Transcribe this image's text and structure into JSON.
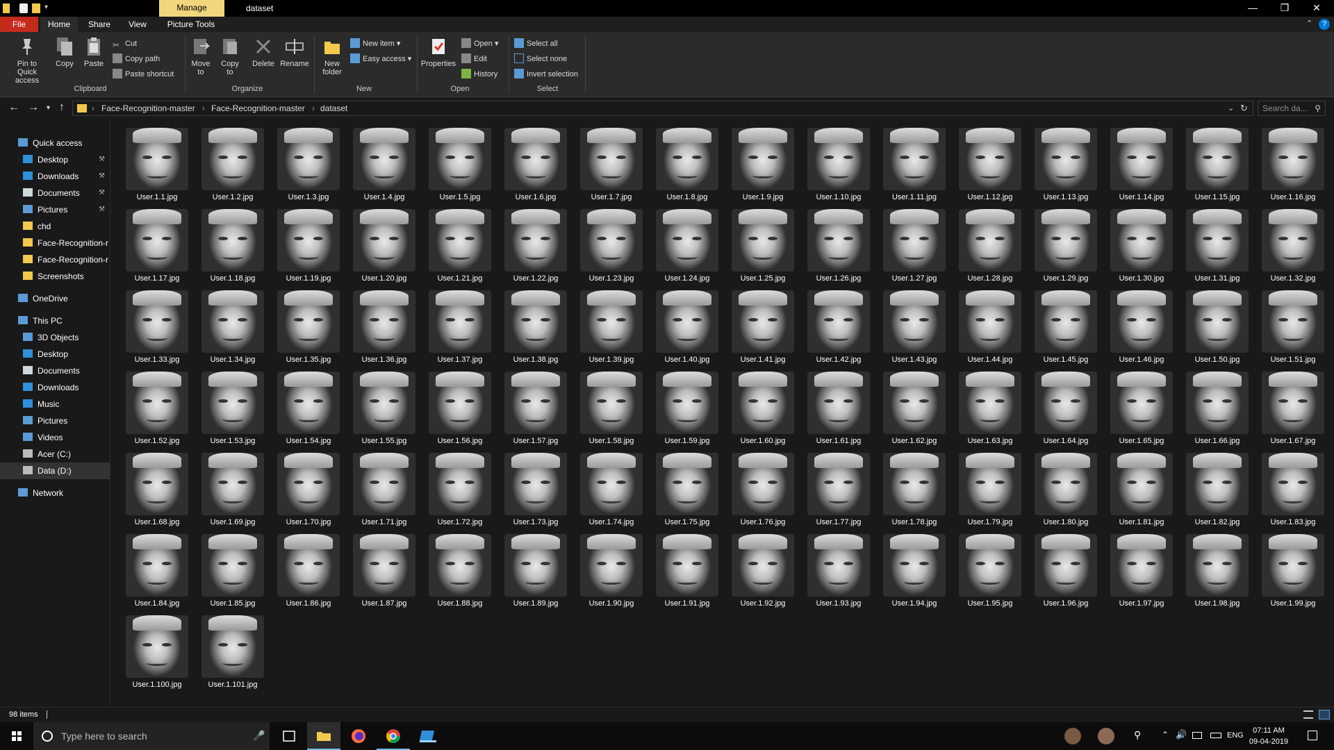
{
  "window": {
    "manage_tab": "Manage",
    "title": "dataset"
  },
  "ribbon_tabs": {
    "file": "File",
    "home": "Home",
    "share": "Share",
    "view": "View",
    "picture_tools": "Picture Tools"
  },
  "ribbon": {
    "clipboard": {
      "pin": "Pin to Quick access",
      "copy": "Copy",
      "paste": "Paste",
      "cut": "Cut",
      "copy_path": "Copy path",
      "paste_shortcut": "Paste shortcut",
      "label": "Clipboard"
    },
    "organize": {
      "move_to": "Move to",
      "copy_to": "Copy to",
      "delete": "Delete",
      "rename": "Rename",
      "label": "Organize"
    },
    "new": {
      "new_folder": "New folder",
      "new_item": "New item",
      "easy_access": "Easy access",
      "label": "New"
    },
    "open": {
      "properties": "Properties",
      "open": "Open",
      "edit": "Edit",
      "history": "History",
      "label": "Open"
    },
    "select": {
      "select_all": "Select all",
      "select_none": "Select none",
      "invert_selection": "Invert selection",
      "label": "Select"
    }
  },
  "address": {
    "crumbs": [
      "Face-Recognition-master",
      "Face-Recognition-master",
      "dataset"
    ],
    "search_placeholder": "Search da..."
  },
  "sidebar": {
    "quick_access": "Quick access",
    "quick_items": [
      {
        "label": "Desktop",
        "icon": "desktop-icon",
        "pinned": true
      },
      {
        "label": "Downloads",
        "icon": "download-icon",
        "pinned": true
      },
      {
        "label": "Documents",
        "icon": "document-icon",
        "pinned": true
      },
      {
        "label": "Pictures",
        "icon": "pictures-icon",
        "pinned": true
      },
      {
        "label": "chd",
        "icon": "folder-icon",
        "pinned": false
      },
      {
        "label": "Face-Recognition-r",
        "icon": "folder-icon",
        "pinned": false
      },
      {
        "label": "Face-Recognition-r",
        "icon": "folder-icon",
        "pinned": false
      },
      {
        "label": "Screenshots",
        "icon": "folder-icon",
        "pinned": false
      }
    ],
    "onedrive": "OneDrive",
    "this_pc": "This PC",
    "pc_items": [
      {
        "label": "3D Objects",
        "icon": "cube-icon"
      },
      {
        "label": "Desktop",
        "icon": "desktop-icon"
      },
      {
        "label": "Documents",
        "icon": "document-icon"
      },
      {
        "label": "Downloads",
        "icon": "download-icon"
      },
      {
        "label": "Music",
        "icon": "music-icon"
      },
      {
        "label": "Pictures",
        "icon": "pictures-icon"
      },
      {
        "label": "Videos",
        "icon": "video-icon"
      },
      {
        "label": "Acer (C:)",
        "icon": "drive-icon"
      },
      {
        "label": "Data (D:)",
        "icon": "drive-icon"
      }
    ],
    "network": "Network"
  },
  "files": [
    "User.1.1.jpg",
    "User.1.2.jpg",
    "User.1.3.jpg",
    "User.1.4.jpg",
    "User.1.5.jpg",
    "User.1.6.jpg",
    "User.1.7.jpg",
    "User.1.8.jpg",
    "User.1.9.jpg",
    "User.1.10.jpg",
    "User.1.11.jpg",
    "User.1.12.jpg",
    "User.1.13.jpg",
    "User.1.14.jpg",
    "User.1.15.jpg",
    "User.1.16.jpg",
    "User.1.17.jpg",
    "User.1.18.jpg",
    "User.1.19.jpg",
    "User.1.20.jpg",
    "User.1.21.jpg",
    "User.1.22.jpg",
    "User.1.23.jpg",
    "User.1.24.jpg",
    "User.1.25.jpg",
    "User.1.26.jpg",
    "User.1.27.jpg",
    "User.1.28.jpg",
    "User.1.29.jpg",
    "User.1.30.jpg",
    "User.1.31.jpg",
    "User.1.32.jpg",
    "User.1.33.jpg",
    "User.1.34.jpg",
    "User.1.35.jpg",
    "User.1.36.jpg",
    "User.1.37.jpg",
    "User.1.38.jpg",
    "User.1.39.jpg",
    "User.1.40.jpg",
    "User.1.41.jpg",
    "User.1.42.jpg",
    "User.1.43.jpg",
    "User.1.44.jpg",
    "User.1.45.jpg",
    "User.1.46.jpg",
    "User.1.50.jpg",
    "User.1.51.jpg",
    "User.1.52.jpg",
    "User.1.53.jpg",
    "User.1.54.jpg",
    "User.1.55.jpg",
    "User.1.56.jpg",
    "User.1.57.jpg",
    "User.1.58.jpg",
    "User.1.59.jpg",
    "User.1.60.jpg",
    "User.1.61.jpg",
    "User.1.62.jpg",
    "User.1.63.jpg",
    "User.1.64.jpg",
    "User.1.65.jpg",
    "User.1.66.jpg",
    "User.1.67.jpg",
    "User.1.68.jpg",
    "User.1.69.jpg",
    "User.1.70.jpg",
    "User.1.71.jpg",
    "User.1.72.jpg",
    "User.1.73.jpg",
    "User.1.74.jpg",
    "User.1.75.jpg",
    "User.1.76.jpg",
    "User.1.77.jpg",
    "User.1.78.jpg",
    "User.1.79.jpg",
    "User.1.80.jpg",
    "User.1.81.jpg",
    "User.1.82.jpg",
    "User.1.83.jpg",
    "User.1.84.jpg",
    "User.1.85.jpg",
    "User.1.86.jpg",
    "User.1.87.jpg",
    "User.1.88.jpg",
    "User.1.89.jpg",
    "User.1.90.jpg",
    "User.1.91.jpg",
    "User.1.92.jpg",
    "User.1.93.jpg",
    "User.1.94.jpg",
    "User.1.95.jpg",
    "User.1.96.jpg",
    "User.1.97.jpg",
    "User.1.98.jpg",
    "User.1.99.jpg",
    "User.1.100.jpg",
    "User.1.101.jpg"
  ],
  "status": {
    "item_count": "98 items"
  },
  "taskbar": {
    "search_placeholder": "Type here to search",
    "language": "ENG",
    "time": "07:11 AM",
    "date": "09-04-2019"
  },
  "colors": {
    "background": "#191919",
    "ribbon": "#2b2b2b",
    "file_tab": "#c42b1c",
    "manage_tab": "#f1d67e",
    "accent": "#0078d7"
  }
}
